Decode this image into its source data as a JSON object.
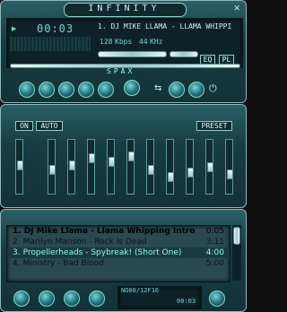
{
  "player": {
    "title": "INFINITY",
    "marquee": "1. DJ MIKE LLAMA - LLAMA WHIPPI",
    "kbps": "128",
    "kbps_unit": "Kbps",
    "khz": "44",
    "khz_unit": "KHz",
    "time": "00:03",
    "brand": "SPAX",
    "eq_label": "EQ",
    "pl_label": "PL"
  },
  "equalizer": {
    "on_label": "ON",
    "auto_label": "AUTO",
    "presets_label": "PRESET",
    "sliders": [
      0.45,
      0.55,
      0.45,
      0.3,
      0.38,
      0.25,
      0.55,
      0.72,
      0.62,
      0.5,
      0.65
    ]
  },
  "playlist": {
    "items": [
      {
        "index": "1.",
        "title": "DJ Mike Llama - Llama Whipping Intro",
        "duration": "0:05"
      },
      {
        "index": "2.",
        "title": "Marilyn Manson - Rock Is Dead",
        "duration": "3:11"
      },
      {
        "index": "3.",
        "title": "Propellerheads - Spybreak! (Short One)",
        "duration": "4:00"
      },
      {
        "index": "4.",
        "title": "Ministry - Bad Blood",
        "duration": "5:00"
      }
    ],
    "info": "NO00/12F16",
    "time": "00:03"
  },
  "colors": {
    "accent": "#3fa7b0",
    "lcd_text": "#7fd0d6"
  }
}
